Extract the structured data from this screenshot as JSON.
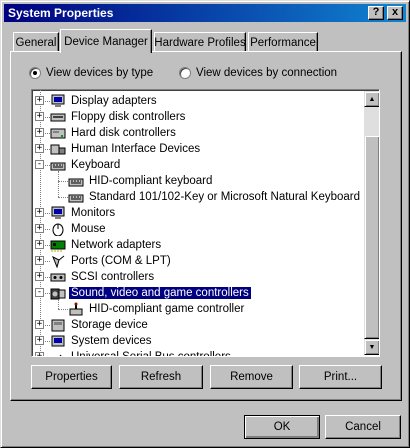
{
  "window": {
    "title": "System Properties"
  },
  "titlebar": {
    "help_label": "?",
    "close_label": "x"
  },
  "tabs": [
    {
      "label": "General"
    },
    {
      "label": "Device Manager"
    },
    {
      "label": "Hardware Profiles"
    },
    {
      "label": "Performance"
    }
  ],
  "view_options": {
    "by_type": {
      "label": "View devices by type",
      "selected": true
    },
    "by_connection": {
      "label": "View devices by connection",
      "selected": false
    }
  },
  "devices": [
    {
      "label": "Display adapters",
      "icon": "monitor-icon",
      "expander": "+"
    },
    {
      "label": "Floppy disk controllers",
      "icon": "floppy-controller-icon",
      "expander": "+"
    },
    {
      "label": "Hard disk controllers",
      "icon": "disk-controller-icon",
      "expander": "+"
    },
    {
      "label": "Human Interface Devices",
      "icon": "hid-icon",
      "expander": "+"
    },
    {
      "label": "Keyboard",
      "icon": "keyboard-icon",
      "expander": "-"
    },
    {
      "label": "HID-compliant keyboard",
      "icon": "keyboard-icon",
      "child": true
    },
    {
      "label": "Standard 101/102-Key or Microsoft Natural Keyboard",
      "icon": "keyboard-icon",
      "child": true
    },
    {
      "label": "Monitors",
      "icon": "monitor-icon",
      "expander": "+"
    },
    {
      "label": "Mouse",
      "icon": "mouse-icon",
      "expander": "+"
    },
    {
      "label": "Network adapters",
      "icon": "network-adapter-icon",
      "expander": "+"
    },
    {
      "label": "Ports (COM & LPT)",
      "icon": "port-icon",
      "expander": "+"
    },
    {
      "label": "SCSI controllers",
      "icon": "scsi-icon",
      "expander": "+"
    },
    {
      "label": "Sound, video and game controllers",
      "icon": "sound-icon",
      "expander": "-",
      "selected": true
    },
    {
      "label": "HID-compliant game controller",
      "icon": "game-controller-icon",
      "child": true
    },
    {
      "label": "Storage device",
      "icon": "storage-icon",
      "expander": "+"
    },
    {
      "label": "System devices",
      "icon": "system-device-icon",
      "expander": "+"
    },
    {
      "label": "Universal Serial Bus controllers",
      "icon": "usb-icon",
      "expander": "+"
    }
  ],
  "scrollbar": {
    "up": "▲",
    "down": "▼"
  },
  "buttons": {
    "properties": "Properties",
    "refresh": "Refresh",
    "remove": "Remove",
    "print": "Print...",
    "ok": "OK",
    "cancel": "Cancel"
  },
  "colors": {
    "titlebar_start": "#000080",
    "titlebar_end": "#1084d0",
    "selection": "#000080",
    "face": "#c0c0c0"
  }
}
